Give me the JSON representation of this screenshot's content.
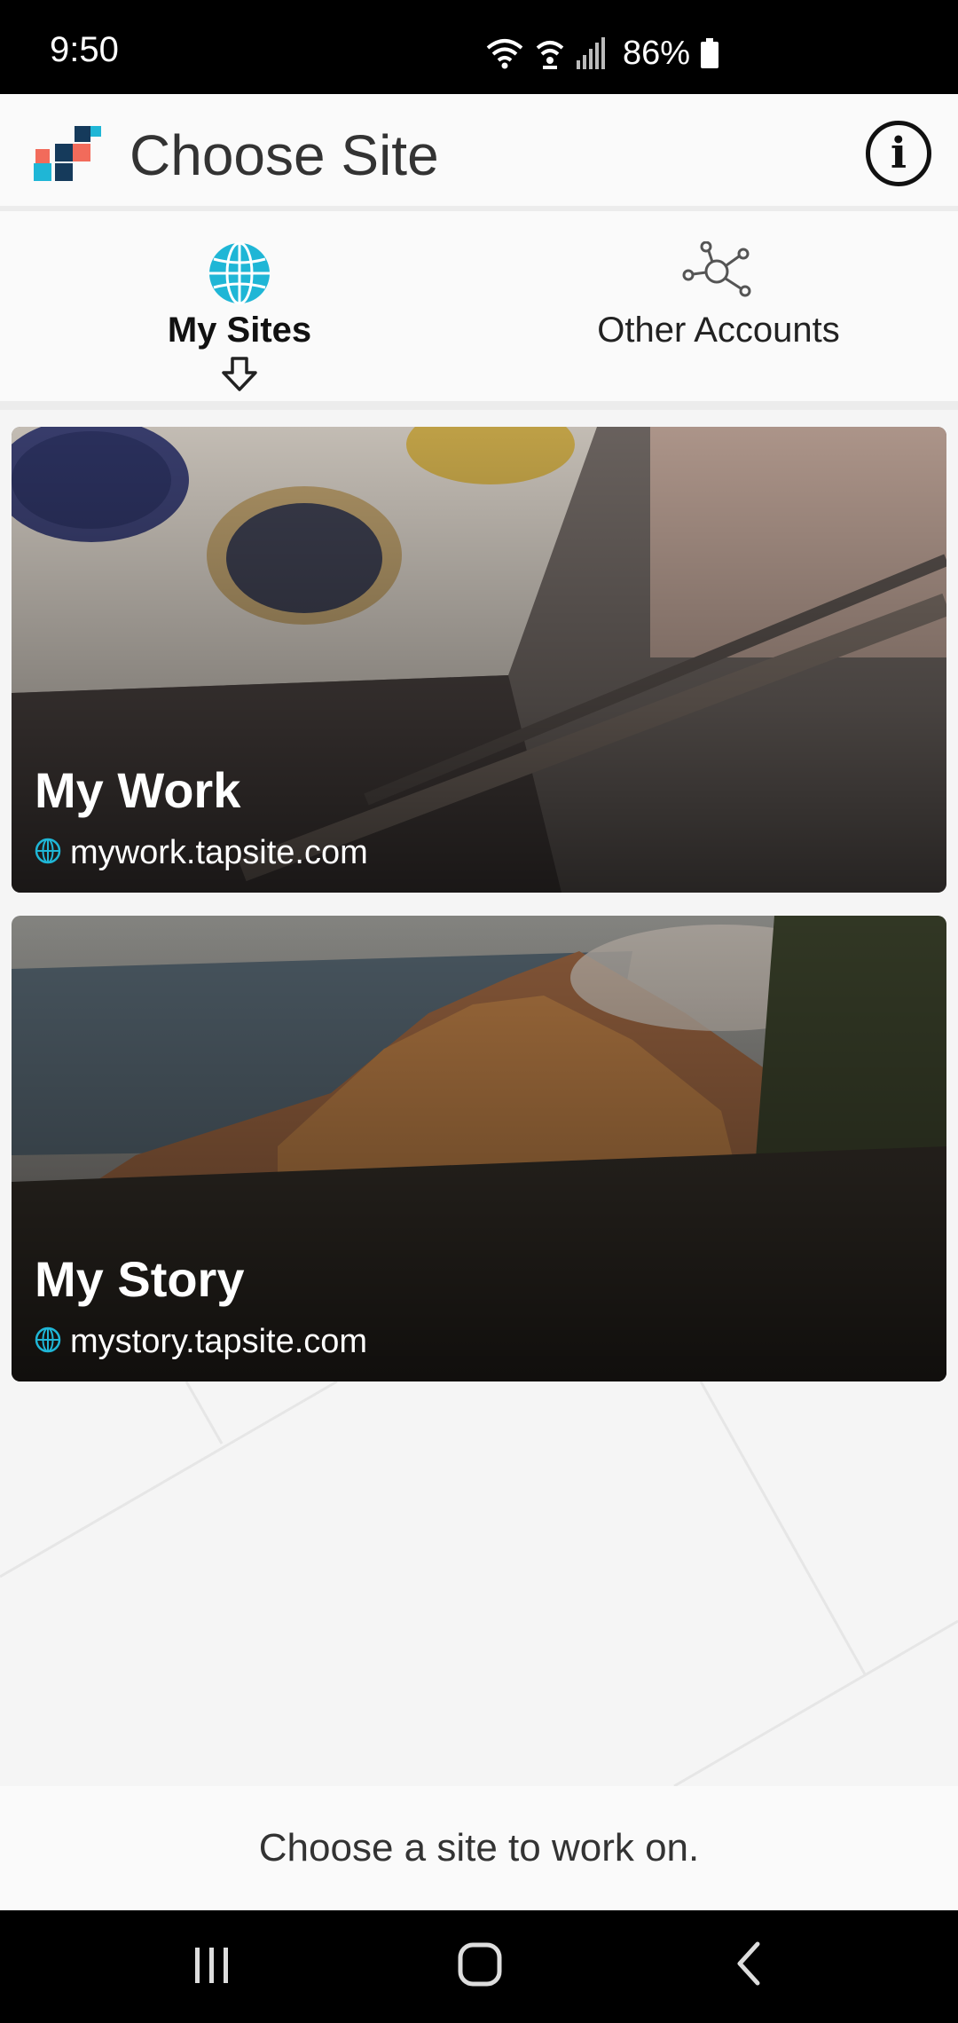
{
  "status_bar": {
    "time": "9:50",
    "battery_percent": "86%",
    "icons": [
      "wifi-icon",
      "hotspot-icon",
      "signal-icon",
      "battery-icon"
    ]
  },
  "app_bar": {
    "title": "Choose Site",
    "logo_icon": "tapsite-logo-icon",
    "info_icon": "info-icon",
    "info_symbol": "i"
  },
  "tabs": [
    {
      "label": "My Sites",
      "icon": "globe-icon",
      "selected": true
    },
    {
      "label": "Other Accounts",
      "icon": "network-icon",
      "selected": false
    }
  ],
  "sites": [
    {
      "title": "My Work",
      "url": "mywork.tapsite.com",
      "icon": "globe-icon"
    },
    {
      "title": "My Story",
      "url": "mystory.tapsite.com",
      "icon": "globe-icon"
    }
  ],
  "footer": {
    "message": "Choose a site to work on."
  },
  "nav_bar": {
    "buttons": [
      "recent-apps-icon",
      "home-icon",
      "back-icon"
    ]
  },
  "colors": {
    "accent": "#1fb6d6",
    "logo_navy": "#153a5b",
    "logo_coral": "#f26b5b"
  }
}
